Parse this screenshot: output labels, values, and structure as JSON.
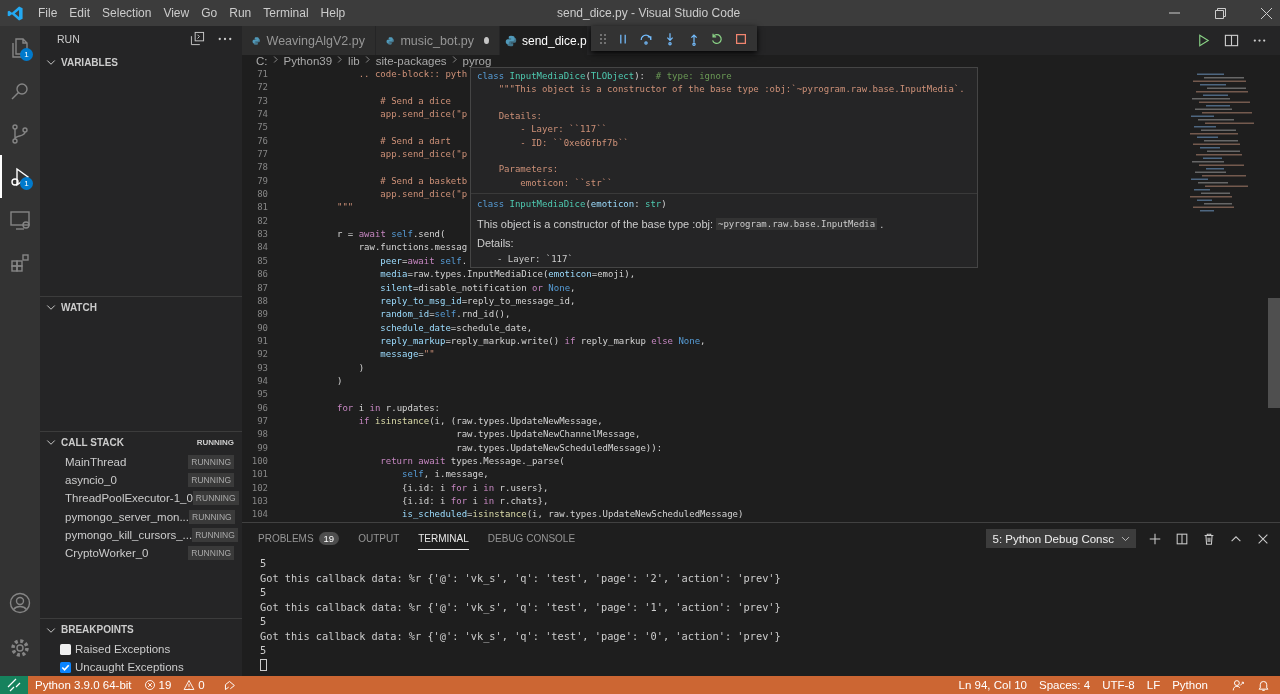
{
  "title_bar": {
    "menu": [
      "File",
      "Edit",
      "Selection",
      "View",
      "Go",
      "Run",
      "Terminal",
      "Help"
    ],
    "title": "send_dice.py - Visual Studio Code"
  },
  "activity_bar": {
    "items": [
      {
        "kind": "explorer",
        "selected": false,
        "badge": "1"
      },
      {
        "kind": "search",
        "selected": false
      },
      {
        "kind": "source_control",
        "selected": false
      },
      {
        "kind": "run",
        "selected": true,
        "badge": "1"
      },
      {
        "kind": "remote",
        "selected": false
      },
      {
        "kind": "extensions",
        "selected": false
      }
    ],
    "bottom": [
      {
        "kind": "account"
      },
      {
        "kind": "settings"
      }
    ]
  },
  "sidebar": {
    "title": "RUN",
    "sections": [
      {
        "kind": "variables",
        "title": "VARIABLES",
        "expanded": true
      },
      {
        "kind": "watch",
        "title": "WATCH",
        "expanded": true
      },
      {
        "kind": "call_stack",
        "title": "CALL STACK",
        "expanded": true,
        "status": "RUNNING",
        "threads": [
          {
            "name": "MainThread",
            "status": "RUNNING"
          },
          {
            "name": "asyncio_0",
            "status": "RUNNING"
          },
          {
            "name": "ThreadPoolExecutor-1_0",
            "status": "RUNNING"
          },
          {
            "name": "pymongo_server_mon...",
            "status": "RUNNING"
          },
          {
            "name": "pymongo_kill_cursors_...",
            "status": "RUNNING"
          },
          {
            "name": "CryptoWorker_0",
            "status": "RUNNING"
          }
        ]
      },
      {
        "kind": "breakpoints",
        "title": "BREAKPOINTS",
        "expanded": true,
        "items": [
          {
            "label": "Raised Exceptions",
            "checked": false
          },
          {
            "label": "Uncaught Exceptions",
            "checked": true
          }
        ]
      }
    ]
  },
  "tabs": [
    {
      "label": "WeavingAlgV2.py",
      "selected": false,
      "dirty": false
    },
    {
      "label": "music_bot.py",
      "selected": false,
      "dirty": true
    },
    {
      "label": "send_dice.p",
      "selected": true,
      "dirty": false
    }
  ],
  "debug_toolbar": {
    "buttons": [
      {
        "kind": "pause"
      },
      {
        "kind": "step_over"
      },
      {
        "kind": "step_into"
      },
      {
        "kind": "step_out"
      },
      {
        "kind": "restart"
      },
      {
        "kind": "stop"
      }
    ]
  },
  "editor": {
    "breadcrumb": [
      "C:",
      "Python39",
      "lib",
      "site-packages",
      "pyrog"
    ],
    "actions": [
      {
        "kind": "run"
      },
      {
        "kind": "split"
      },
      {
        "kind": "more"
      }
    ],
    "lines": [
      {
        "number": "71",
        "segments": [
          {
            "text": "                .. code-block:: pyth",
            "kind": "str"
          }
        ]
      },
      {
        "number": "72"
      },
      {
        "number": "73",
        "segments": [
          {
            "text": "                    # Send a dice",
            "kind": "str"
          }
        ]
      },
      {
        "number": "74",
        "segments": [
          {
            "text": "                    app.send_dice(\"p",
            "kind": "str"
          }
        ]
      },
      {
        "number": "75"
      },
      {
        "number": "76",
        "segments": [
          {
            "text": "                    # Send a dart",
            "kind": "str"
          }
        ]
      },
      {
        "number": "77",
        "segments": [
          {
            "text": "                    app.send_dice(\"p",
            "kind": "str"
          }
        ]
      },
      {
        "number": "78"
      },
      {
        "number": "79",
        "segments": [
          {
            "text": "                    # Send a basketb",
            "kind": "str"
          }
        ]
      },
      {
        "number": "80",
        "segments": [
          {
            "text": "                    app.send_dice(\"p",
            "kind": "str"
          }
        ]
      },
      {
        "number": "81",
        "segments": [
          {
            "text": "            \"\"\"",
            "kind": "str"
          }
        ]
      },
      {
        "number": "82"
      },
      {
        "number": "83",
        "segments": [
          {
            "text": "            r = ",
            "kind": "plain"
          },
          {
            "text": "await",
            "kind": "kw"
          },
          {
            "text": " self",
            "kind": "const"
          },
          {
            "text": ".send(",
            "kind": "plain"
          }
        ]
      },
      {
        "number": "84",
        "segments": [
          {
            "text": "                raw.functions.messag",
            "kind": "plain"
          }
        ]
      },
      {
        "number": "85",
        "segments": [
          {
            "text": "                    peer",
            "kind": "param"
          },
          {
            "text": "=",
            "kind": "plain"
          },
          {
            "text": "await",
            "kind": "kw"
          },
          {
            "text": " self",
            "kind": "const"
          },
          {
            "text": ".",
            "kind": "plain"
          }
        ]
      },
      {
        "number": "86",
        "segments": [
          {
            "text": "                    media",
            "kind": "param"
          },
          {
            "text": "=raw.types.InputMediaDice(",
            "kind": "plain"
          },
          {
            "text": "emoticon",
            "kind": "param"
          },
          {
            "text": "=emoji),",
            "kind": "plain"
          }
        ]
      },
      {
        "number": "87",
        "segments": [
          {
            "text": "                    silent",
            "kind": "param"
          },
          {
            "text": "=disable_notification ",
            "kind": "plain"
          },
          {
            "text": "or",
            "kind": "kw"
          },
          {
            "text": " None",
            "kind": "const"
          },
          {
            "text": ",",
            "kind": "plain"
          }
        ]
      },
      {
        "number": "88",
        "segments": [
          {
            "text": "                    reply_to_msg_id",
            "kind": "param"
          },
          {
            "text": "=reply_to_message_id,",
            "kind": "plain"
          }
        ]
      },
      {
        "number": "89",
        "segments": [
          {
            "text": "                    random_id",
            "kind": "param"
          },
          {
            "text": "=",
            "kind": "plain"
          },
          {
            "text": "self",
            "kind": "const"
          },
          {
            "text": ".rnd_id(),",
            "kind": "plain"
          }
        ]
      },
      {
        "number": "90",
        "segments": [
          {
            "text": "                    schedule_date",
            "kind": "param"
          },
          {
            "text": "=schedule_date,",
            "kind": "plain"
          }
        ]
      },
      {
        "number": "91",
        "segments": [
          {
            "text": "                    reply_markup",
            "kind": "param"
          },
          {
            "text": "=reply_markup.write() ",
            "kind": "plain"
          },
          {
            "text": "if",
            "kind": "kw"
          },
          {
            "text": " reply_markup ",
            "kind": "plain"
          },
          {
            "text": "else",
            "kind": "kw"
          },
          {
            "text": " None",
            "kind": "const"
          },
          {
            "text": ",",
            "kind": "plain"
          }
        ]
      },
      {
        "number": "92",
        "segments": [
          {
            "text": "                    message",
            "kind": "param"
          },
          {
            "text": "=",
            "kind": "plain"
          },
          {
            "text": "\"\"",
            "kind": "str"
          }
        ]
      },
      {
        "number": "93",
        "segments": [
          {
            "text": "                )",
            "kind": "plain"
          }
        ]
      },
      {
        "number": "94",
        "segments": [
          {
            "text": "            )",
            "kind": "plain"
          }
        ]
      },
      {
        "number": "95"
      },
      {
        "number": "96",
        "segments": [
          {
            "text": "            for",
            "kind": "kw"
          },
          {
            "text": " i ",
            "kind": "plain"
          },
          {
            "text": "in",
            "kind": "kw"
          },
          {
            "text": " r.updates:",
            "kind": "plain"
          }
        ]
      },
      {
        "number": "97",
        "segments": [
          {
            "text": "                if",
            "kind": "kw"
          },
          {
            "text": " isinstance",
            "kind": "fn"
          },
          {
            "text": "(i, (raw.types.UpdateNewMessage,",
            "kind": "plain"
          }
        ]
      },
      {
        "number": "98",
        "segments": [
          {
            "text": "                                  raw.types.UpdateNewChannelMessage,",
            "kind": "plain"
          }
        ]
      },
      {
        "number": "99",
        "segments": [
          {
            "text": "                                  raw.types.UpdateNewScheduledMessage)):",
            "kind": "plain"
          }
        ]
      },
      {
        "number": "100",
        "segments": [
          {
            "text": "                    return",
            "kind": "kw"
          },
          {
            "text": " await",
            "kind": "kw"
          },
          {
            "text": " types.Message._parse(",
            "kind": "plain"
          }
        ]
      },
      {
        "number": "101",
        "segments": [
          {
            "text": "                        self",
            "kind": "const"
          },
          {
            "text": ", i.message,",
            "kind": "plain"
          }
        ]
      },
      {
        "number": "102",
        "segments": [
          {
            "text": "                        {i.id: i ",
            "kind": "plain"
          },
          {
            "text": "for",
            "kind": "kw"
          },
          {
            "text": " i ",
            "kind": "plain"
          },
          {
            "text": "in",
            "kind": "kw"
          },
          {
            "text": " r.users},",
            "kind": "plain"
          }
        ]
      },
      {
        "number": "103",
        "segments": [
          {
            "text": "                        {i.id: i ",
            "kind": "plain"
          },
          {
            "text": "for",
            "kind": "kw"
          },
          {
            "text": " i ",
            "kind": "plain"
          },
          {
            "text": "in",
            "kind": "kw"
          },
          {
            "text": " r.chats},",
            "kind": "plain"
          }
        ]
      },
      {
        "number": "104",
        "segments": [
          {
            "text": "                        is_scheduled",
            "kind": "param"
          },
          {
            "text": "=",
            "kind": "plain"
          },
          {
            "text": "isinstance",
            "kind": "fn"
          },
          {
            "text": "(i, raw.types.UpdateNewScheduledMessage)",
            "kind": "plain"
          }
        ]
      }
    ]
  },
  "hover": {
    "source_blocks": [
      {
        "lines": [
          {
            "segments": [
              {
                "text": "class",
                "kind": "const"
              },
              {
                "text": " InputMediaDice",
                "kind": "cls"
              },
              {
                "text": "(",
                "kind": "plain"
              },
              {
                "text": "TLObject",
                "kind": "cls"
              },
              {
                "text": "):  ",
                "kind": "plain"
              },
              {
                "text": "# type: ignore",
                "kind": "comment"
              }
            ]
          },
          {
            "segments": [
              {
                "text": "    \"\"\"This object is a constructor of the base type :obj:`~pyrogram.raw.base.InputMedia`.",
                "kind": "str"
              }
            ]
          }
        ]
      },
      {
        "lines": [
          {
            "segments": [
              {
                "text": "    Details:",
                "kind": "str"
              }
            ]
          },
          {
            "segments": [
              {
                "text": "        - Layer: ``117``",
                "kind": "str"
              }
            ]
          },
          {
            "segments": [
              {
                "text": "        - ID: ``0xe66fbf7b``",
                "kind": "str"
              }
            ]
          }
        ]
      },
      {
        "lines": [
          {
            "segments": [
              {
                "text": "    Parameters:",
                "kind": "str"
              }
            ]
          },
          {
            "segments": [
              {
                "text": "        emoticon: ``str``",
                "kind": "str"
              }
            ]
          }
        ]
      }
    ],
    "signature": [
      {
        "text": "class",
        "kind": "const"
      },
      {
        "text": " InputMediaDice",
        "kind": "cls"
      },
      {
        "text": "(",
        "kind": "plain"
      },
      {
        "text": "emoticon",
        "kind": "param"
      },
      {
        "text": ": ",
        "kind": "plain"
      },
      {
        "text": "str",
        "kind": "cls"
      },
      {
        "text": ")",
        "kind": "plain"
      }
    ],
    "description": "This object is a constructor of the base type :obj:",
    "description_code": "~pyrogram.raw.base.InputMedia",
    "description_end": ".",
    "details_label": "Details:",
    "details_item": "- Layer: `117`"
  },
  "panel": {
    "tabs": [
      {
        "label": "PROBLEMS",
        "selected": false,
        "badge": "19"
      },
      {
        "label": "OUTPUT",
        "selected": false
      },
      {
        "label": "TERMINAL",
        "selected": true
      },
      {
        "label": "DEBUG CONSOLE",
        "selected": false
      }
    ],
    "terminal_picker": "5: Python Debug Consc",
    "actions": [
      {
        "kind": "add"
      },
      {
        "kind": "split"
      },
      {
        "kind": "trash"
      },
      {
        "kind": "maximize"
      },
      {
        "kind": "close"
      }
    ],
    "terminal_lines": [
      "5",
      "Got this callback data: %r {'@': 'vk_s', 'q': 'test', 'page': '2', 'action': 'prev'}",
      "5",
      "Got this callback data: %r {'@': 'vk_s', 'q': 'test', 'page': '1', 'action': 'prev'}",
      "5",
      "Got this callback data: %r {'@': 'vk_s', 'q': 'test', 'page': '0', 'action': 'prev'}",
      "5"
    ]
  },
  "status_bar": {
    "interpreter": "Python 3.9.0 64-bit",
    "errors": "19",
    "warnings": "0",
    "right": [
      "Ln 94, Col 10",
      "Spaces: 4",
      "UTF-8",
      "LF",
      "Python"
    ]
  }
}
